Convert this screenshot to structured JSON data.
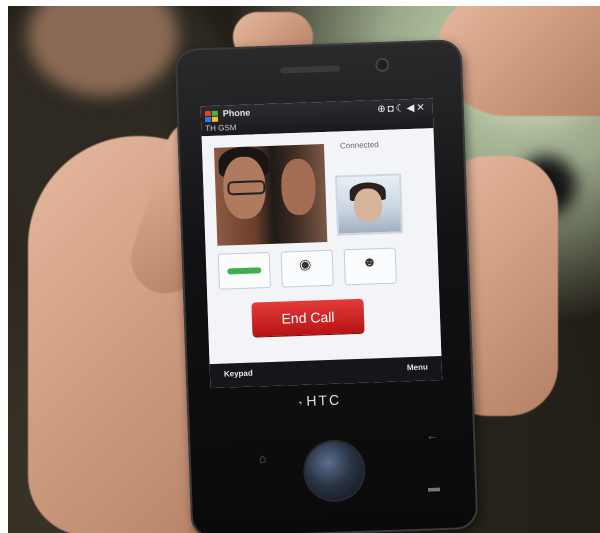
{
  "phone": {
    "brand": "HTC",
    "app_title": "Phone",
    "carrier": "TH GSM",
    "status_icons": "⊕◘☾◀✕",
    "call": {
      "status": "Connected",
      "controls": [
        {
          "icon": "volume-icon",
          "label": ""
        },
        {
          "icon": "mute-icon",
          "label": ""
        },
        {
          "icon": "contacts-icon",
          "label": ""
        }
      ],
      "end_call_label": "End Call"
    },
    "softkeys": {
      "left": "Keypad",
      "right": "Menu"
    }
  },
  "colors": {
    "end_call": "#c81e1e",
    "volume_bar": "#3cb04a",
    "screen_bg": "#e9eef4"
  }
}
